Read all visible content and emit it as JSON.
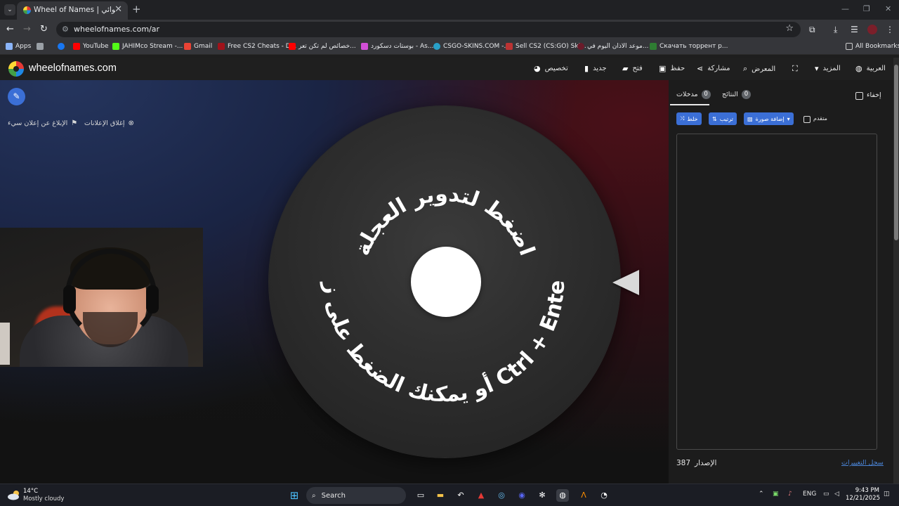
{
  "browser": {
    "tab_title": "Wheel of Names | اسم العشوائي",
    "url": "wheelofnames.com/ar",
    "tab_close": "✕",
    "new_tab": "+"
  },
  "bookmarks": [
    {
      "label": "Apps",
      "color": "#8ab4f8"
    },
    {
      "label": "",
      "color": "#8ab4f8"
    },
    {
      "label": "",
      "color": "#1877f2"
    },
    {
      "label": "YouTube",
      "color": "#ff0000"
    },
    {
      "label": "JAHIMco Stream -...",
      "color": "#53fc18"
    },
    {
      "label": "Gmail",
      "color": "#ea4335"
    },
    {
      "label": "Free CS2 Cheats - D...",
      "color": "#a0121a"
    },
    {
      "label": "خصائص لم تكن تعر...",
      "color": "#ff0000"
    },
    {
      "label": "بوستات دسكورد - As...",
      "color": "#d14fd6"
    },
    {
      "label": "CSGO-SKINS.COM -...",
      "color": "#28a0c8"
    },
    {
      "label": "Sell CS2 (CS:GO) Ski...",
      "color": "#b33"
    },
    {
      "label": "موعد الاذان اليوم في...",
      "color": "#6a1b2a"
    },
    {
      "label": "Скачать торрент р...",
      "color": "#2e7d32"
    }
  ],
  "all_bookmarks": "All Bookmarks",
  "site": {
    "brand": "wheelofnames.com",
    "menu": {
      "customize": "تخصيص",
      "new": "جديد",
      "open": "فتح",
      "save": "حفظ",
      "share": "مشاركة",
      "gallery": "المعرض",
      "more": "المزيد",
      "language": "العربية"
    }
  },
  "stage": {
    "close_ads": "إغلاق الإعلانات",
    "report_ad": "الإبلاغ عن إعلان سيء",
    "wheel_text_top": "اضغط لتدوير العجلة",
    "wheel_text_bottom": "أو يمكنك الضغط على زر Ctrl + Enter"
  },
  "panel": {
    "tab_entries": "مدخلات",
    "entries_count": "0",
    "tab_results": "النتائج",
    "results_count": "0",
    "hide": "إخفاء",
    "shuffle": "خلط",
    "sort": "ترتيب",
    "add_image": "إضافة صورة",
    "advanced": "متقدم",
    "version_label": "الإصدار",
    "version_number": "387",
    "changelog": "سجل التغييرات"
  },
  "taskbar": {
    "temperature": "14°C",
    "weather": "Mostly cloudy",
    "search": "Search",
    "language": "ENG",
    "time": "9:43 PM",
    "date": "12/21/2025"
  },
  "colors": {
    "accent": "#3b6fd6",
    "link": "#4a84d6"
  }
}
